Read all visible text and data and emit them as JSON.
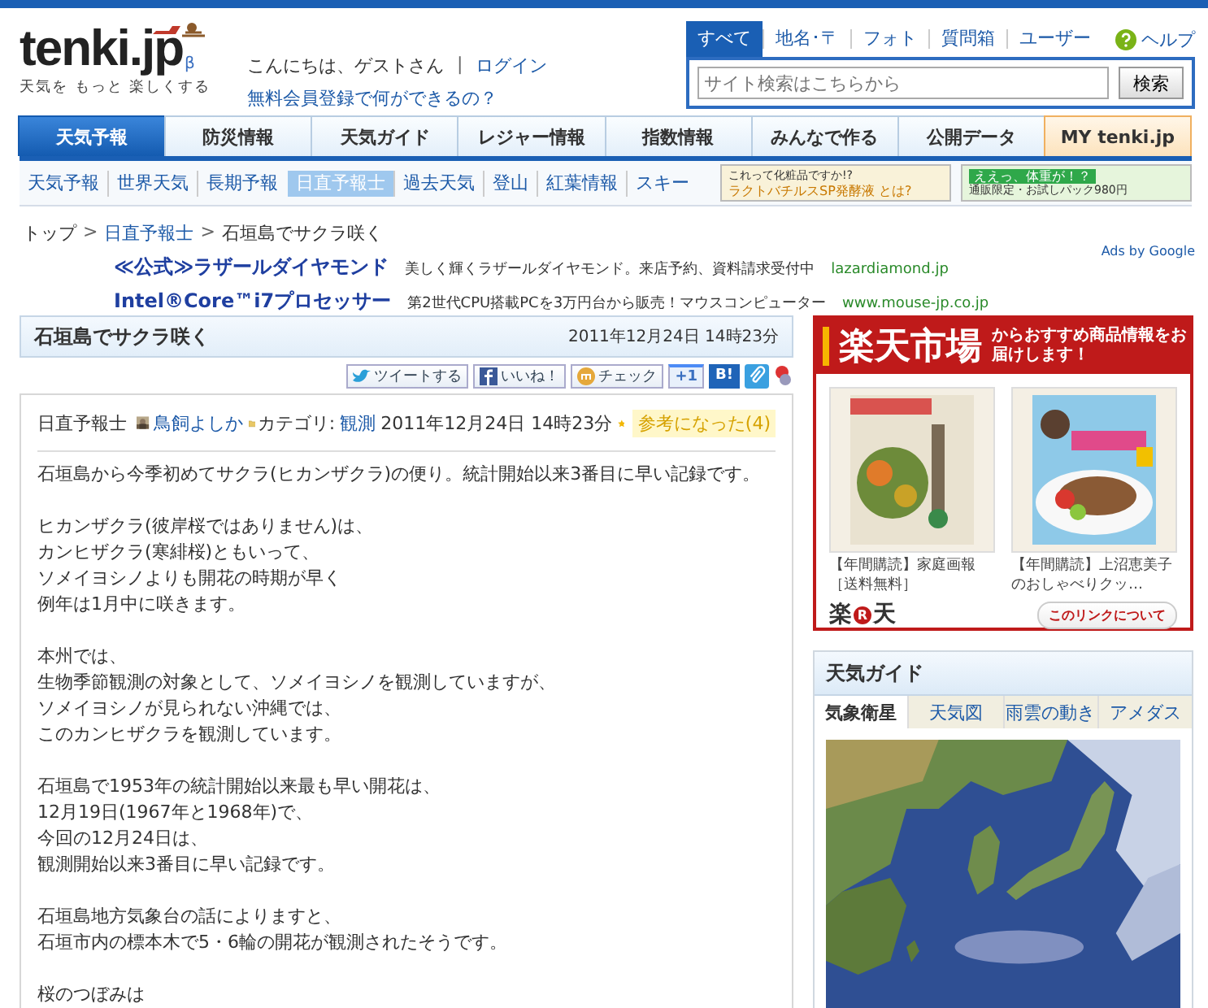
{
  "header": {
    "logo": "tenki.jp",
    "beta": "β",
    "tagline": "天気を もっと 楽しくする",
    "greeting": "こんにちは、ゲストさん",
    "separator": "|",
    "login": "ログイン",
    "signup": "無料会員登録で何ができるの？",
    "search_tabs": [
      {
        "label": "すべて",
        "selected": true
      },
      {
        "label": "地名･〒",
        "selected": false
      },
      {
        "label": "フォト",
        "selected": false
      },
      {
        "label": "質問箱",
        "selected": false
      },
      {
        "label": "ユーザー",
        "selected": false
      }
    ],
    "search": {
      "placeholder": "サイト検索はこちらから",
      "button": "検索"
    },
    "help": "ヘルプ"
  },
  "main_nav": [
    {
      "label": "天気予報",
      "selected": true,
      "kind": "normal"
    },
    {
      "label": "防災情報",
      "selected": false,
      "kind": "normal"
    },
    {
      "label": "天気ガイド",
      "selected": false,
      "kind": "normal"
    },
    {
      "label": "レジャー情報",
      "selected": false,
      "kind": "normal"
    },
    {
      "label": "指数情報",
      "selected": false,
      "kind": "normal"
    },
    {
      "label": "みんなで作る",
      "selected": false,
      "kind": "normal"
    },
    {
      "label": "公開データ",
      "selected": false,
      "kind": "normal"
    },
    {
      "label": "MY tenki.jp",
      "selected": false,
      "kind": "my"
    }
  ],
  "sub_nav": [
    {
      "label": "天気予報",
      "selected": false
    },
    {
      "label": "世界天気",
      "selected": false
    },
    {
      "label": "長期予報",
      "selected": false
    },
    {
      "label": "日直予報士",
      "selected": true
    },
    {
      "label": "過去天気",
      "selected": false
    },
    {
      "label": "登山",
      "selected": false
    },
    {
      "label": "紅葉情報",
      "selected": false
    },
    {
      "label": "スキー",
      "selected": false
    }
  ],
  "banners": [
    {
      "top": "これって化粧品ですか!?",
      "bottom": "ラクトバチルスSP発酵液 とは?"
    },
    {
      "top": "ええっ、体重が！？",
      "bottom": "通販限定・お試しパック980円"
    }
  ],
  "breadcrumb": {
    "separator": ">",
    "items": [
      {
        "label": "トップ",
        "link": false
      },
      {
        "label": "日直予報士",
        "link": true
      },
      {
        "label": "石垣島でサクラ咲く",
        "link": false
      }
    ]
  },
  "ads": {
    "label": "Ads by Google",
    "items": [
      {
        "title": "≪公式≫ラザールダイヤモンド",
        "text": "美しく輝くラザールダイヤモンド。来店予約、資料請求受付中",
        "url": "lazardiamond.jp"
      },
      {
        "title": "Intel®Core™i7プロセッサー",
        "text": "第2世代CPU搭載PCを3万円台から販売！マウスコンピューター",
        "url": "www.mouse-jp.co.jp"
      }
    ]
  },
  "article": {
    "title": "石垣島でサクラ咲く",
    "date": "2011年12月24日 14時23分",
    "share": [
      {
        "kind": "tweet",
        "label": "ツイートする"
      },
      {
        "kind": "like",
        "label": "いいね！"
      },
      {
        "kind": "check",
        "label": "チェック"
      },
      {
        "kind": "plusone",
        "label": "+1"
      },
      {
        "kind": "hatena",
        "label": "B!"
      },
      {
        "kind": "clip"
      },
      {
        "kind": "other"
      }
    ],
    "meta": {
      "role": "日直予報士",
      "author": "鳥飼よしか",
      "category_label": "カテゴリ:",
      "category": "観測",
      "date": "2011年12月24日 14時23分",
      "helpful": "参考になった(4)"
    },
    "paragraphs": [
      [
        "石垣島から今季初めてサクラ(ヒカンザクラ)の便り。統計開始以来3番目に早い記録です。"
      ],
      [
        "ヒカンザクラ(彼岸桜ではありません)は、",
        "カンヒザクラ(寒緋桜)ともいって、",
        "ソメイヨシノよりも開花の時期が早く",
        "例年は1月中に咲きます。"
      ],
      [
        "本州では、",
        "生物季節観測の対象として、ソメイヨシノを観測していますが、",
        "ソメイヨシノが見られない沖縄では、",
        "このカンヒザクラを観測しています。"
      ],
      [
        "石垣島で1953年の統計開始以来最も早い開花は、",
        "12月19日(1967年と1968年)で、",
        "今回の12月24日は、",
        "観測開始以来3番目に早い記録です。"
      ],
      [
        "石垣島地方気象台の話によりますと、",
        "石垣市内の標本木で5・6輪の開花が観測されたそうです。"
      ],
      [
        "桜のつぼみは"
      ]
    ]
  },
  "rakuten": {
    "logo": "楽天市場",
    "tagline": "からおすすめ商品情報をお届けします！",
    "products": [
      {
        "caption": "【年間購読】家庭画報［送料無料］",
        "kind": "picture"
      },
      {
        "caption": "【年間購読】上沼恵美子のおしゃべりクッ…",
        "kind": "picture"
      }
    ],
    "brand": [
      "楽",
      "R",
      "天"
    ],
    "about": "このリンクについて"
  },
  "weather_guide": {
    "title": "天気ガイド",
    "tabs": [
      {
        "label": "気象衛星",
        "selected": true
      },
      {
        "label": "天気図",
        "selected": false
      },
      {
        "label": "雨雲の動き",
        "selected": false
      },
      {
        "label": "アメダス",
        "selected": false
      }
    ],
    "kind": "picture"
  }
}
